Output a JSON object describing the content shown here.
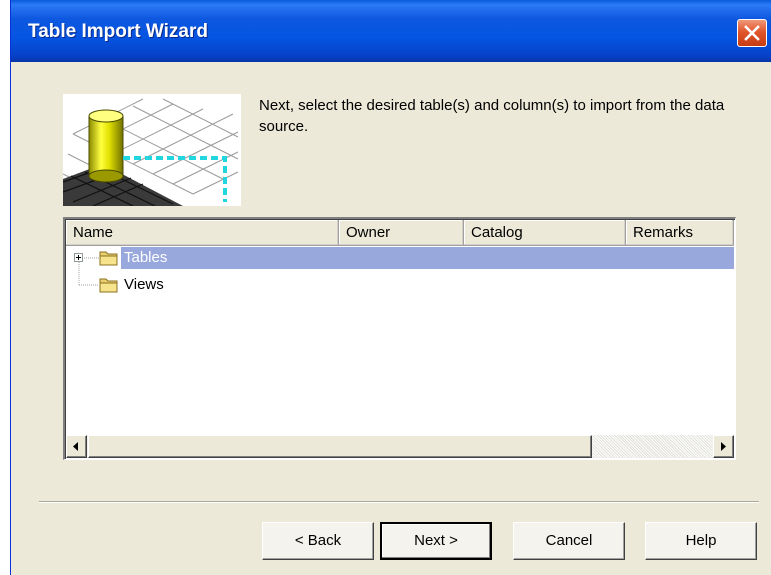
{
  "window": {
    "title": "Table Import Wizard"
  },
  "wizard": {
    "instruction": "Next, select the desired table(s) and column(s) to import from the data source."
  },
  "listview": {
    "columns": [
      "Name",
      "Owner",
      "Catalog",
      "Remarks"
    ],
    "items": [
      {
        "label": "Tables",
        "selected": true,
        "expandable": true
      },
      {
        "label": "Views",
        "selected": false,
        "expandable": false
      }
    ]
  },
  "buttons": {
    "back": "< Back",
    "next": "Next >",
    "cancel": "Cancel",
    "help": "Help"
  },
  "colors": {
    "titlebar": "#0554e2",
    "selection": "#98a8dc",
    "dialog_bg": "#ece9d8"
  },
  "icons": {
    "close": "close-icon",
    "folder": "folder-icon",
    "expand": "plus-expander-icon",
    "database": "database-cylinder-icon"
  }
}
